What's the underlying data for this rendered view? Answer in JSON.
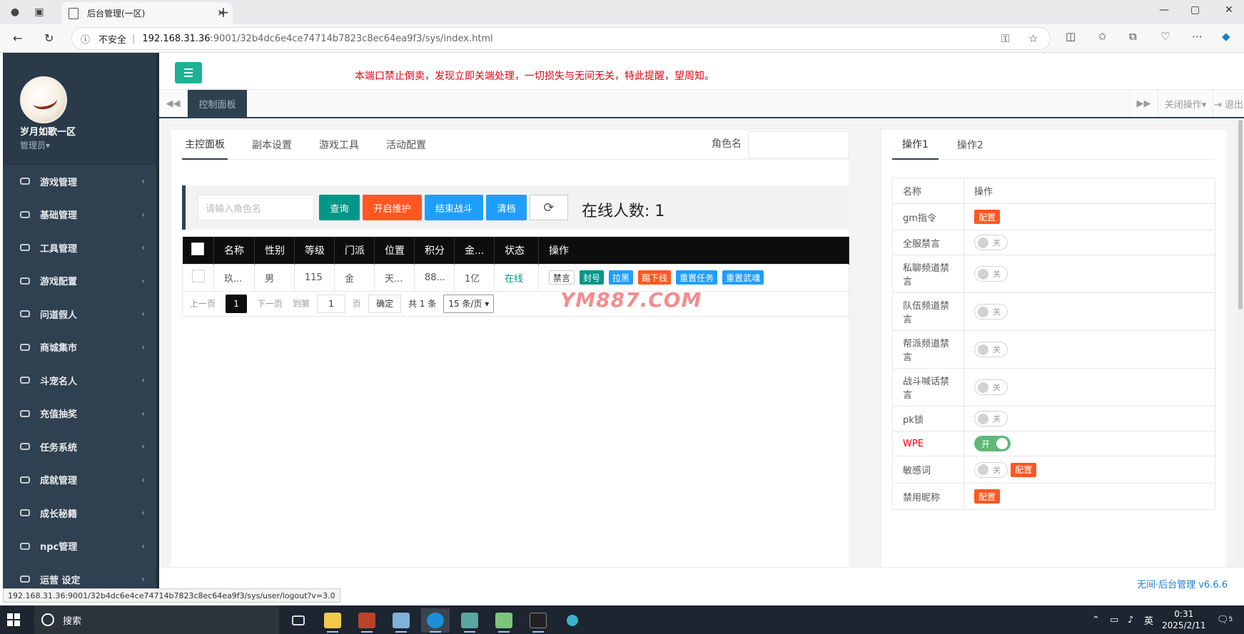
{
  "browser": {
    "tab_title": "后台管理(一区)",
    "new_tab": "+",
    "security_label": "不安全",
    "url_host": "192.168.31.36",
    "url_rest": ":9001/32b4dc6e4ce74714b7823c8ec64ea9f3/sys/index.html",
    "min": "—",
    "max": "▢",
    "close": "✕",
    "back": "←",
    "reload": "↻",
    "more": "⋯"
  },
  "sidebar": {
    "user_name": "岁月如歌一区",
    "user_role": "管理员▾",
    "items": [
      {
        "label": "游戏管理"
      },
      {
        "label": "基础管理"
      },
      {
        "label": "工具管理"
      },
      {
        "label": "游戏配置"
      },
      {
        "label": "问道假人"
      },
      {
        "label": "商城集市"
      },
      {
        "label": "斗宠名人"
      },
      {
        "label": "充值抽奖"
      },
      {
        "label": "任务系统"
      },
      {
        "label": "成就管理"
      },
      {
        "label": "成长秘籍"
      },
      {
        "label": "npc管理"
      },
      {
        "label": "运营 设定"
      }
    ],
    "chevron": "‹"
  },
  "topbar": {
    "notice": "本端口禁止倒卖，发现立即关端处理，一切损失与无间无关，特此提醒，望周知。"
  },
  "tabsbar": {
    "prev": "◀◀",
    "next": "▶▶",
    "active_tab": "控制面板",
    "close_ops": "关闭操作▾",
    "logout": "⇥ 退出"
  },
  "main": {
    "tabs": [
      "主控面板",
      "副本设置",
      "游戏工具",
      "活动配置"
    ],
    "role_label": "角色名",
    "search_placeholder": "请输入角色名",
    "buttons": {
      "query": "查询",
      "maintenance": "开启维护",
      "end_battle": "结束战斗",
      "clear": "清档",
      "refresh": "⟳"
    },
    "online_label": "在线人数:",
    "online_count": "1",
    "table": {
      "headers": [
        "名称",
        "性别",
        "等级",
        "门派",
        "位置",
        "积分",
        "金...",
        "状态",
        "操作"
      ],
      "rows": [
        {
          "name": "玖...",
          "gender": "男",
          "level": "115",
          "faction": "金",
          "location": "天...",
          "points": "88...",
          "gold": "1亿",
          "status": "在线",
          "ops": [
            "禁言",
            "封号",
            "拉黑",
            "踢下线",
            "重置任务",
            "重置武魂"
          ]
        }
      ]
    },
    "pager": {
      "prev": "上一页",
      "current": "1",
      "next": "下一页",
      "goto": "到第",
      "page_input": "1",
      "page_unit": "页",
      "confirm": "确定",
      "total": "共 1 条",
      "per_page": "15 条/页 ▾"
    },
    "watermark": "YM887.COM"
  },
  "right": {
    "tabs": [
      "操作1",
      "操作2"
    ],
    "header": {
      "name": "名称",
      "op": "操作"
    },
    "rows": [
      {
        "name": "gm指令",
        "type": "config"
      },
      {
        "name": "全服禁言",
        "type": "switch"
      },
      {
        "name": "私聊频道禁言",
        "type": "switch"
      },
      {
        "name": "队伍频道禁言",
        "type": "switch"
      },
      {
        "name": "帮派频道禁言",
        "type": "switch"
      },
      {
        "name": "战斗喊话禁言",
        "type": "switch"
      },
      {
        "name": "pk锁",
        "type": "switch"
      },
      {
        "name": "WPE",
        "type": "switch_on"
      },
      {
        "name": "敏感词",
        "type": "switch_config"
      },
      {
        "name": "禁用昵称",
        "type": "config"
      }
    ],
    "switch_off": "关",
    "switch_on": "开",
    "config_label": "配置"
  },
  "footer": {
    "text": "无间·后台管理 v6.6.6"
  },
  "status_url": "192.168.31.36:9001/32b4dc6e4ce74714b7823c8ec64ea9f3/sys/user/logout?v=3.0",
  "taskbar": {
    "search": "搜索",
    "ime": "英",
    "time": "0:31",
    "date": "2025/2/11",
    "notif": "5"
  },
  "colors": {
    "sidebar": "#2f4050",
    "teal": "#009688",
    "orange": "#ff5722",
    "blue": "#1e9fff",
    "green_toggle": "#1ab394",
    "notice_red": "#e60012"
  }
}
